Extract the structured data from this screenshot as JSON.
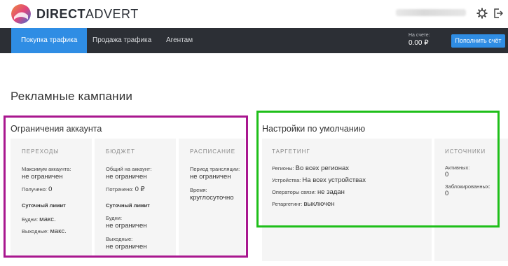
{
  "brand": {
    "strong": "DIRECT",
    "light": "ADVERT"
  },
  "header": {
    "email_masked": "",
    "settings_icon": "gear-icon",
    "logout_icon": "logout-icon"
  },
  "nav": {
    "tabs": [
      {
        "label": "Покупка трафика",
        "active": true
      },
      {
        "label": "Продажа трафика",
        "active": false
      },
      {
        "label": "Агентам",
        "active": false
      }
    ],
    "balance_label": "На счете:",
    "balance_value": "0.00 ₽",
    "topup_label": "Пополнить счёт"
  },
  "colors": {
    "accent": "#2f8de4",
    "nav_bg": "#2c2f35",
    "highlight_purple": "#a9178f",
    "highlight_green": "#1fbf1a"
  },
  "page_title": "Рекламные кампании",
  "limits": {
    "title": "Ограничения аккаунта",
    "transitions": {
      "title": "ПЕРЕХОДЫ",
      "max_label": "Максимум аккаунта:",
      "max_value": "не ограничен",
      "received_label": "Получено:",
      "received_value": "0",
      "daily_title": "Суточный лимит",
      "weekdays_label": "Будни:",
      "weekdays_value": "макс.",
      "weekends_label": "Выходные:",
      "weekends_value": "макс."
    },
    "budget": {
      "title": "БЮДЖЕТ",
      "total_label": "Общий на аккаунт:",
      "total_value": "не ограничен",
      "spent_label": "Потрачено:",
      "spent_value": "0 ₽",
      "daily_title": "Суточный лимит",
      "weekdays_label": "Будни:",
      "weekdays_value": "не ограничен",
      "weekends_label": "Выходные:",
      "weekends_value": "не ограничен"
    },
    "schedule": {
      "title": "РАСПИСАНИЕ",
      "period_label": "Период трансляции:",
      "period_value": "не ограничен",
      "time_label": "Время:",
      "time_value": "круглосуточно"
    }
  },
  "defaults": {
    "title": "Настройки по умолчанию",
    "targeting": {
      "title": "ТАРГЕТИНГ",
      "regions_label": "Регионы:",
      "regions_value": "Во всех регионах",
      "devices_label": "Устройства:",
      "devices_value": "На всех устройствах",
      "operators_label": "Операторы связи:",
      "operators_value": "не задан",
      "retargeting_label": "Ретаргетинг:",
      "retargeting_value": "выключен"
    },
    "sources": {
      "title": "ИСТОЧНИКИ",
      "active_label": "Активных:",
      "active_value": "0",
      "blocked_label": "Заблокированных:",
      "blocked_value": "0"
    }
  }
}
